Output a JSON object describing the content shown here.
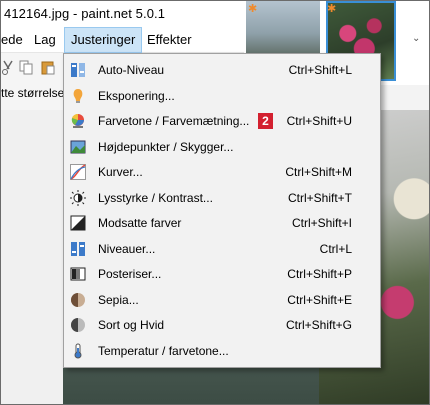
{
  "window": {
    "title": "412164.jpg - paint.net 5.0.1"
  },
  "menubar": {
    "items": [
      {
        "label": "ede"
      },
      {
        "label": "Lag"
      },
      {
        "label": "Justeringer"
      },
      {
        "label": "Effekter"
      }
    ]
  },
  "toolbar": {
    "partial_label": "tte størrelse"
  },
  "adjustments_menu": {
    "items": [
      {
        "label": "Auto-Niveau",
        "shortcut": "Ctrl+Shift+L",
        "icon": "auto-level-icon"
      },
      {
        "label": "Eksponering...",
        "shortcut": "",
        "icon": "exposure-icon"
      },
      {
        "label": "Farvetone / Farvemætning...",
        "shortcut": "Ctrl+Shift+U",
        "icon": "hue-saturation-icon",
        "badge": "2"
      },
      {
        "label": "Højdepunkter / Skygger...",
        "shortcut": "",
        "icon": "highlights-shadows-icon"
      },
      {
        "label": "Kurver...",
        "shortcut": "Ctrl+Shift+M",
        "icon": "curves-icon"
      },
      {
        "label": "Lysstyrke / Kontrast...",
        "shortcut": "Ctrl+Shift+T",
        "icon": "brightness-contrast-icon"
      },
      {
        "label": "Modsatte farver",
        "shortcut": "Ctrl+Shift+I",
        "icon": "invert-colors-icon"
      },
      {
        "label": "Niveauer...",
        "shortcut": "Ctrl+L",
        "icon": "levels-icon"
      },
      {
        "label": "Posteriser...",
        "shortcut": "Ctrl+Shift+P",
        "icon": "posterize-icon"
      },
      {
        "label": "Sepia...",
        "shortcut": "Ctrl+Shift+E",
        "icon": "sepia-icon"
      },
      {
        "label": "Sort og Hvid",
        "shortcut": "Ctrl+Shift+G",
        "icon": "black-white-icon"
      },
      {
        "label": "Temperatur / farvetone...",
        "shortcut": "",
        "icon": "temperature-icon"
      }
    ]
  },
  "colors": {
    "menu_highlight": "#cce4f7",
    "badge": "#d3202f",
    "accent": "#3a8fd6"
  }
}
